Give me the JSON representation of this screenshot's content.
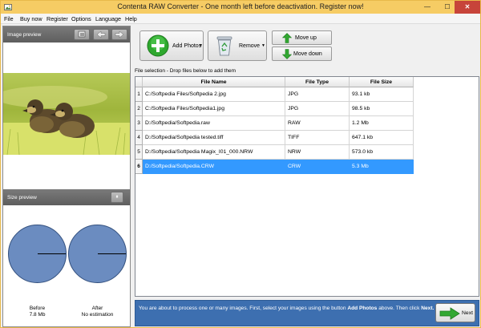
{
  "window": {
    "title": "Contenta RAW Converter  -  One month left before deactivation. Register now!",
    "minimize": "—",
    "maximize": "☐",
    "close": "✕"
  },
  "menu": [
    "File",
    "Buy now",
    "Register",
    "Options",
    "Language",
    "Help"
  ],
  "image_preview": {
    "header": "Image preview"
  },
  "size_preview": {
    "header": "Size preview",
    "pause_icon": "⏸",
    "before_label": "Before",
    "before_value": "7.8 Mb",
    "after_label": "After",
    "after_value": "No estimation"
  },
  "toolbar": {
    "add_photos": "Add Photos",
    "remove": "Remove",
    "move_up": "Move up",
    "move_down": "Move down",
    "dropdown_arrow": "▼"
  },
  "file_selection_label": "File selection - Drop files below to add them",
  "table": {
    "columns": [
      "File Name",
      "File Type",
      "File Size"
    ],
    "rows": [
      {
        "num": "1",
        "name": "C:/Softpedia Files/Softpedia 2.jpg",
        "type": "JPG",
        "size": "93.1 kb"
      },
      {
        "num": "2",
        "name": "C:/Softpedia Files/Softpedia1.jpg",
        "type": "JPG",
        "size": "98.5 kb"
      },
      {
        "num": "3",
        "name": "D:/Softpedia/Softpedia.raw",
        "type": "RAW",
        "size": "1.2 Mb"
      },
      {
        "num": "4",
        "name": "D:/Softpedia/Softpedia tested.tiff",
        "type": "TIFF",
        "size": "647.1 kb"
      },
      {
        "num": "5",
        "name": "D:/Softpedia/Softpedia Magix_I01_000.NRW",
        "type": "NRW",
        "size": "573.0 kb"
      },
      {
        "num": "6",
        "name": "D:/Softpedia/Softpedia.CRW",
        "type": "CRW",
        "size": "5.3 Mb"
      }
    ],
    "selected_row": 6
  },
  "info": {
    "text_a": "You are about to process one or many images. First, select your images using the button ",
    "bold_a": "Add Photos",
    "text_b": " above.  Then click ",
    "bold_b": "Next."
  },
  "next_button": "Next",
  "colors": {
    "titlebar": "#f6cc64",
    "selection": "#3399ff",
    "info_bar": "#3d6fb0",
    "pie_fill": "#6b8cc0",
    "add_green": "#2ea82e",
    "close_red": "#c7443a"
  }
}
